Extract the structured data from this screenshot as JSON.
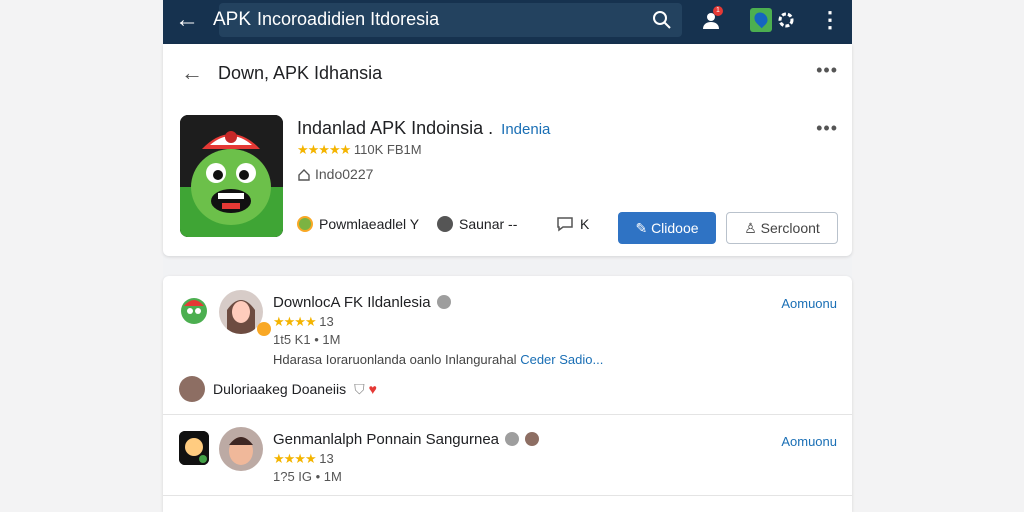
{
  "app_bar": {
    "back_icon": "arrow-left-icon",
    "search_brand": "APK",
    "search_query": "Incoroadidien Itdoresia",
    "search_icon": "search-icon",
    "notification_count": "1",
    "notification_icon": "bell-icon",
    "maps_icon": "maps-icon",
    "settings_icon": "gear-icon",
    "more_icon": "more-vertical-icon"
  },
  "page": {
    "title": "Down, APK Idhansia",
    "more_label": "•••"
  },
  "app": {
    "name": "Indanlad APK Indoinsia",
    "region": "Indenia",
    "rating_stars": "★★★★★",
    "rating_text": "110K FB1M",
    "home_text": "Indo0227",
    "more_label": "•••",
    "actions": {
      "download_label": "Powmlaeadlel Y",
      "source_label": "Saunar",
      "source_suffix": "--",
      "comments_label": "K",
      "primary_label": "Clidooe",
      "secondary_label": "Sercloont"
    },
    "colors": {
      "primary": "#2f73c4",
      "link": "#1a6fb5",
      "header": "#16324f"
    }
  },
  "reviews": [
    {
      "name": "DownlocA FK Ildanlesia",
      "stars": "★★★★",
      "rating_suffix": "13",
      "meta": "1t5 K1 • 1M",
      "description": "Hdarasa Ioraruonlanda oanlo Inlangurahal",
      "description_link": "Ceder Sadio...",
      "action_label": "Aomuonu"
    },
    {
      "name": "Genmanlalph Ponnain Sangurnea",
      "stars": "★★★★",
      "rating_suffix": "13",
      "meta": "1?5 IG • 1M",
      "action_label": "Aomuonu"
    }
  ],
  "review_footnote": {
    "text": "Duloriaakeg Doaneiis",
    "shield_icon": "shield-icon",
    "heart_icon": "heart-icon"
  }
}
